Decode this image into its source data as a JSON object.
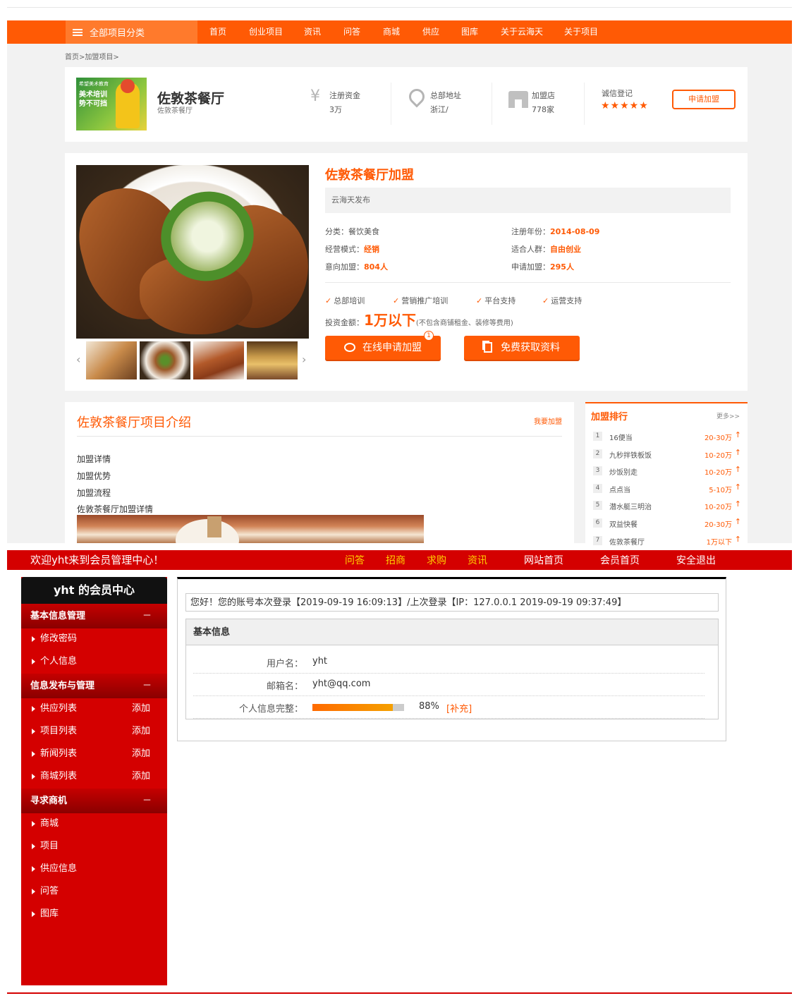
{
  "nav": {
    "category": "全部项目分类",
    "items": [
      "首页",
      "创业项目",
      "资讯",
      "问答",
      "商城",
      "供应",
      "图库",
      "关于云海天",
      "关于项目"
    ]
  },
  "breadcrumb": "首页>加盟项目>",
  "brand": {
    "logo_text": "美术培训\n势不可挡",
    "logo_small": "希望美术教育",
    "name": "佐敦茶餐厅",
    "sub": "佐敦茶餐厅",
    "capital_label": "注册资金",
    "capital_value": "3万",
    "hq_label": "总部地址",
    "hq_value": "浙江/",
    "stores_label": "加盟店",
    "stores_value": "778家",
    "credit_label": "诚信登记",
    "stars": "★★★★★",
    "apply_button": "申请加盟"
  },
  "product": {
    "title": "佐敦茶餐厅加盟",
    "publisher": "云海天发布",
    "category_label": "分类：",
    "category_value": "餐饮美食",
    "year_label": "注册年份：",
    "year_value": "2014-08-09",
    "mode_label": "经营模式：",
    "mode_value": "经销",
    "crowd_label": "适合人群：",
    "crowd_value": "自由创业",
    "intent_label": "意向加盟：",
    "intent_value": "804人",
    "apply_label": "申请加盟：",
    "apply_value": "295人",
    "features": [
      "总部培训",
      "营销推广培训",
      "平台支持",
      "运营支持"
    ],
    "check": "✓",
    "invest_label": "投资金额：",
    "invest_value": "1万以下",
    "invest_note": "(不包含商铺租金、装修等费用)",
    "btn_online": "在线申请加盟",
    "btn_free": "免费获取资料",
    "badge": "1",
    "arrow_left": "‹",
    "arrow_right": "›"
  },
  "intro": {
    "title": "佐敦茶餐厅项目介绍",
    "join_link": "我要加盟",
    "items": [
      "加盟详情",
      "加盟优势",
      "加盟流程",
      "佐敦茶餐厅加盟详情"
    ]
  },
  "ranking": {
    "title": "加盟排行",
    "more": "更多>>",
    "up": "↑",
    "rows": [
      {
        "n": "1",
        "name": "16便当",
        "value": "20-30万"
      },
      {
        "n": "2",
        "name": "九秒拌铁板饭",
        "value": "10-20万"
      },
      {
        "n": "3",
        "name": "炒饭别走",
        "value": "10-20万"
      },
      {
        "n": "4",
        "name": "点点当",
        "value": "5-10万"
      },
      {
        "n": "5",
        "name": "潜水艇三明治",
        "value": "10-20万"
      },
      {
        "n": "6",
        "name": "双益快餐",
        "value": "20-30万"
      },
      {
        "n": "7",
        "name": "佐敦茶餐厅",
        "value": "1万以下"
      }
    ]
  },
  "member": {
    "welcome": "欢迎yht来到会员管理中心！",
    "links": [
      {
        "label": "问答",
        "color": "#ffd200"
      },
      {
        "label": "招商",
        "color": "#ffd200"
      },
      {
        "label": "求购",
        "color": "#ffd200"
      },
      {
        "label": "资讯",
        "color": "#ffd200"
      },
      {
        "label": "网站首页",
        "color": "#ffffff"
      },
      {
        "label": "会员首页",
        "color": "#ffffff"
      },
      {
        "label": "安全退出",
        "color": "#ffffff"
      }
    ],
    "sidebar_title": "yht 的会员中心",
    "collapse": "－",
    "sections": [
      {
        "title": "基本信息管理",
        "items": [
          {
            "label": "修改密码"
          },
          {
            "label": "个人信息"
          }
        ]
      },
      {
        "title": "信息发布与管理",
        "items": [
          {
            "label": "供应列表",
            "add": "添加"
          },
          {
            "label": "项目列表",
            "add": "添加"
          },
          {
            "label": "新闻列表",
            "add": "添加"
          },
          {
            "label": "商城列表",
            "add": "添加"
          }
        ]
      },
      {
        "title": "寻求商机",
        "items": [
          {
            "label": "商城"
          },
          {
            "label": "项目"
          },
          {
            "label": "供应信息"
          },
          {
            "label": "问答"
          },
          {
            "label": "图库"
          }
        ]
      }
    ],
    "notice": "您好！您的账号本次登录【2019-09-19 16:09:13】/上次登录【IP：127.0.0.1 2019-09-19 09:37:49】",
    "basic_title": "基本信息",
    "username_label": "用户名：",
    "username": "yht",
    "email_label": "邮箱名：",
    "email": "yht@qq.com",
    "complete_label": "个人信息完整：",
    "complete_pct": "88%",
    "complete_fraction": 0.88,
    "supplement": "[补充]"
  },
  "colors": {
    "orange": "#ff5a05",
    "red": "#d40000",
    "yellow": "#ffd200"
  }
}
